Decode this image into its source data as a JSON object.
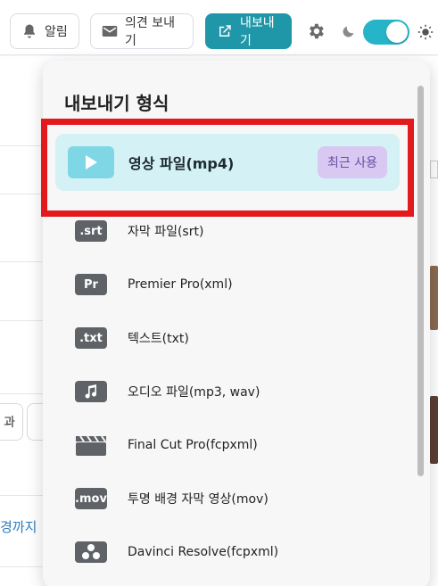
{
  "toolbar": {
    "alarm_label": "알림",
    "feedback_label": "의견 보내기",
    "export_label": "내보내기",
    "icons": {
      "alarm": "bell-icon",
      "feedback": "mail-icon",
      "export": "external-link-icon",
      "settings": "gear-icon",
      "dark_mode": "moon-icon",
      "light_mode": "sun-icon"
    },
    "theme_toggle_on": true
  },
  "background": {
    "chip_left_text": "과",
    "chip_mid_text": "(",
    "link_text": "경까지 ✓"
  },
  "dropdown": {
    "title": "내보내기 형식",
    "options": [
      {
        "icon": "play-icon",
        "label": "영상 파일(mp4)",
        "badge": "최근 사용",
        "selected": true
      },
      {
        "icon_text": ".srt",
        "label": "자막 파일(srt)"
      },
      {
        "icon_text": "Pr",
        "label": "Premier Pro(xml)"
      },
      {
        "icon_text": ".txt",
        "label": "텍스트(txt)"
      },
      {
        "icon": "music-note-icon",
        "label": "오디오 파일(mp3, wav)"
      },
      {
        "icon": "clapperboard-icon",
        "label": "Final Cut Pro(fcpxml)"
      },
      {
        "icon_text": ".mov",
        "label": "투명 배경 자막 영상(mov)"
      },
      {
        "icon": "davinci-icon",
        "label": "Davinci Resolve(fcpxml)"
      }
    ]
  },
  "colors": {
    "accent": "#1f97a8",
    "selected_bg": "#d4f1f5",
    "badge_bg": "#d8c8f2",
    "highlight": "#e3191b"
  }
}
